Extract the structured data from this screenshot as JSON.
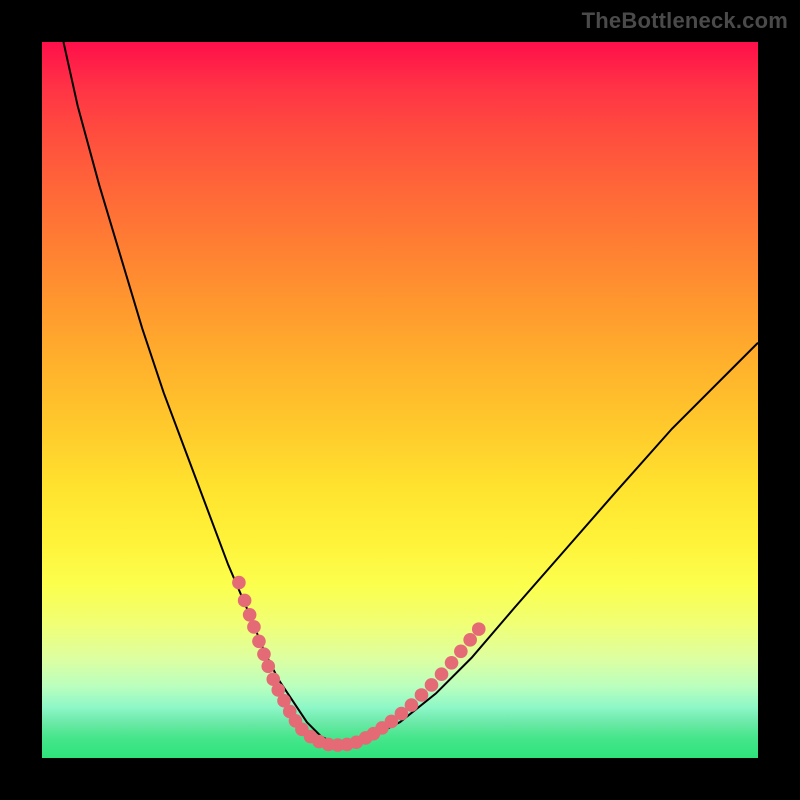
{
  "watermark": "TheBottleneck.com",
  "colors": {
    "frame": "#000000",
    "curve": "#000000",
    "dots": "#e46b76",
    "gradient_top": "#ff0f4a",
    "gradient_bottom": "#2de27a"
  },
  "chart_data": {
    "type": "line",
    "title": "",
    "xlabel": "",
    "ylabel": "",
    "xlim": [
      0,
      100
    ],
    "ylim": [
      0,
      100
    ],
    "series": [
      {
        "name": "bottleneck-curve",
        "x": [
          3,
          5,
          8,
          11,
          14,
          17,
          20,
          23,
          26,
          29,
          31,
          33,
          35,
          37,
          39,
          41,
          43,
          46,
          50,
          55,
          60,
          66,
          73,
          80,
          88,
          96,
          100
        ],
        "y": [
          100,
          91,
          80,
          70,
          60,
          51,
          43,
          35,
          27,
          20,
          15,
          11,
          8,
          5,
          3,
          2,
          2,
          3,
          5,
          9,
          14,
          21,
          29,
          37,
          46,
          54,
          58
        ]
      }
    ],
    "dot_clusters": [
      {
        "name": "left-descent-cluster",
        "points": [
          [
            27.5,
            24.5
          ],
          [
            28.3,
            22.0
          ],
          [
            29.0,
            20.0
          ],
          [
            29.6,
            18.3
          ],
          [
            30.3,
            16.3
          ],
          [
            31.0,
            14.5
          ],
          [
            31.6,
            12.8
          ],
          [
            32.3,
            11.0
          ],
          [
            33.0,
            9.5
          ],
          [
            33.8,
            8.0
          ],
          [
            34.6,
            6.5
          ],
          [
            35.4,
            5.2
          ],
          [
            36.3,
            4.0
          ]
        ]
      },
      {
        "name": "valley-floor-cluster",
        "points": [
          [
            37.5,
            3.0
          ],
          [
            38.7,
            2.3
          ],
          [
            40.0,
            1.9
          ],
          [
            41.3,
            1.8
          ],
          [
            42.6,
            1.9
          ],
          [
            43.9,
            2.2
          ],
          [
            45.2,
            2.8
          ]
        ]
      },
      {
        "name": "right-ascent-cluster",
        "points": [
          [
            46.3,
            3.4
          ],
          [
            47.5,
            4.2
          ],
          [
            48.8,
            5.1
          ],
          [
            50.2,
            6.2
          ],
          [
            51.6,
            7.4
          ],
          [
            53.0,
            8.8
          ],
          [
            54.4,
            10.2
          ],
          [
            55.8,
            11.7
          ],
          [
            57.2,
            13.3
          ],
          [
            58.5,
            14.9
          ],
          [
            59.8,
            16.5
          ],
          [
            61.0,
            18.0
          ]
        ]
      }
    ]
  }
}
